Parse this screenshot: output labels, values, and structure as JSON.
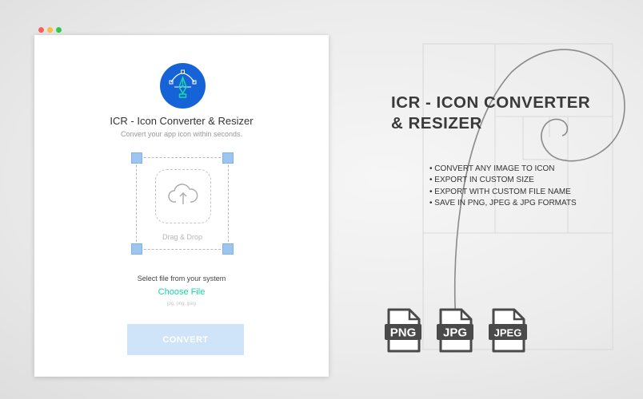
{
  "window": {
    "title": "ICR - Icon Converter & Resizer",
    "subtitle": "Convert your app icon within seconds.",
    "drop_label": "Drag & Drop",
    "select_label": "Select file from your system",
    "choose_file_label": "Choose File",
    "formats_hint": "jpg, png, jpeg",
    "convert_label": "CONVERT"
  },
  "promo": {
    "headline_line1": "ICR - ICON CONVERTER",
    "headline_line2": "& RESIZER",
    "features": [
      "CONVERT ANY IMAGE TO ICON",
      "EXPORT IN CUSTOM SIZE",
      "EXPORT WITH CUSTOM FILE NAME",
      "SAVE IN PNG, JPEG & JPG FORMATS"
    ],
    "file_types": [
      "PNG",
      "JPG",
      "JPEG"
    ]
  },
  "colors": {
    "brand_blue": "#1563d6",
    "accent_green": "#10d6a6",
    "button_disabled": "#cfe4f9",
    "handle_blue": "#9cc6ef"
  },
  "icons": [
    "pen-tool-icon",
    "cloud-upload-icon",
    "png-file-icon",
    "jpg-file-icon",
    "jpeg-file-icon"
  ]
}
